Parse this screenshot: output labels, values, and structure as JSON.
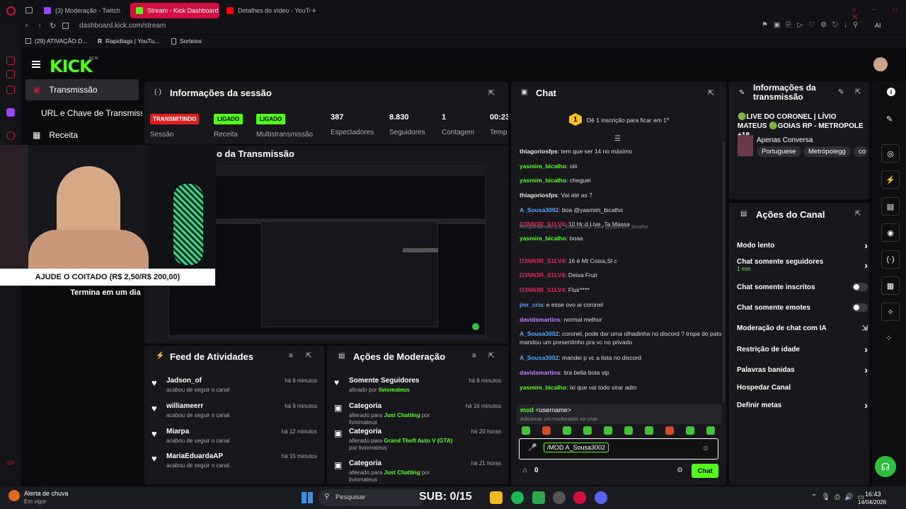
{
  "browser": {
    "tabs": [
      {
        "label": "(3) Moderação - Twitch",
        "color": "#9147ff"
      },
      {
        "label": "Stream - Kick Dashboard",
        "color": "#53fc18"
      },
      {
        "label": "Detalhes do vídeo - YouTu...",
        "color": "#ff0000"
      }
    ],
    "url": "dashboard.kick.com/stream",
    "bookmarks": [
      "(29) ATIVAÇÃO D...",
      "Rapidtags | YouTu...",
      "Sorteios"
    ]
  },
  "kick": {
    "logo": "KICK",
    "logo_sup": "BETA",
    "nav": [
      "Transmissão",
      "URL e Chave de Transmissão",
      "Receita"
    ]
  },
  "session": {
    "title": "Informações da sessão",
    "stats": [
      {
        "badge": "TRANSMITINDO",
        "label": "Sessão"
      },
      {
        "badge": "LIGADO",
        "label": "Receita"
      },
      {
        "badge": "LIGADO",
        "label": "Multistransmissão"
      },
      {
        "value": "387",
        "label": "Espectadores"
      },
      {
        "value": "8.830",
        "label": "Seguidores"
      },
      {
        "value": "1",
        "label": "Contagem"
      },
      {
        "value": "00:23",
        "label": "Temp"
      }
    ]
  },
  "preview": {
    "title_partial": "o da Transmissão"
  },
  "overlay": {
    "goal": "AJUDE O COITADO (R$ 2,50/R$ 200,00)",
    "ends": "Termina em um dia"
  },
  "activity_feed": {
    "title": "Feed de Atividades",
    "items": [
      {
        "name": "Jadson_of",
        "action": "acabou de seguir o canal",
        "time": "há 9 minutos"
      },
      {
        "name": "williameerr",
        "action": "acabou de seguir o canal",
        "time": "há 9 minutos"
      },
      {
        "name": "Miarpa",
        "action": "acabou de seguir o canal",
        "time": "há 12 minutos"
      },
      {
        "name": "MariaEduardaAP",
        "action": "acabou de seguir o canal",
        "time": "há 15 minutos"
      }
    ]
  },
  "mod_actions": {
    "title": "Ações de Moderação",
    "items": [
      {
        "name": "Somente Seguidores",
        "pre": "ativado por",
        "hl": "liviomateus",
        "post": "",
        "time": "há 8 minutos"
      },
      {
        "name": "Categoria",
        "pre": "alterado para",
        "hl": "Just Chatting",
        "post": "por liviomateus",
        "time": "há 16 minutos"
      },
      {
        "name": "Categoria",
        "pre": "alterado para",
        "hl": "Grand Theft Auto V (GTA)",
        "post": "por liviomateus",
        "time": "há 20 horas"
      },
      {
        "name": "Categoria",
        "pre": "alterado para",
        "hl": "Just Chatting",
        "post": "por liviomateus",
        "time": "há 21 horas"
      }
    ]
  },
  "chat": {
    "title": "Chat",
    "sub_goal": "Dê 1 inscrição para ficar em 1º",
    "sub_goal_num": "1",
    "messages": [
      {
        "user": "thiagoriosfps",
        "color": "#e8e8e8",
        "text": "tem que ser 14 no máximo"
      },
      {
        "user": "yasmim_bicalho",
        "color": "#53fc18",
        "text": "oiii"
      },
      {
        "user": "yasmim_bicalho",
        "color": "#53fc18",
        "text": "cheguei"
      },
      {
        "user": "thiagoriosfps",
        "color": "#e8e8e8",
        "text": "Vai até as 7"
      },
      {
        "user": "A_Sousa3002",
        "color": "#4aa8ff",
        "text": "boa @yasmim_bicalho"
      },
      {
        "user": "D3NN3R_S1LV4",
        "color": "#e0245e",
        "text": "10 Hr d Live ,Ta Massa"
      },
      {
        "reply": "Respondendo a A_Sousa3002: boa @yasmim_bicalho",
        "user": "yasmim_bicalho",
        "color": "#53fc18",
        "text": "boaa"
      },
      {
        "user": "D3NN3R_S1LV4",
        "color": "#e0245e",
        "text": "16 é Mt Coisa,Sl c"
      },
      {
        "user": "D3NN3R_S1LV4",
        "color": "#e0245e",
        "text": "Deixa Fruir"
      },
      {
        "user": "D3NN3R_S1LV4",
        "color": "#e0245e",
        "text": "Fluir****"
      },
      {
        "user": "jmr_cria",
        "color": "#4aa8ff",
        "text": "e esse ovo ai coronel"
      },
      {
        "user": "davidsmartins",
        "color": "#c77dff",
        "text": "normal melhor"
      },
      {
        "user": "A_Sousa3002",
        "color": "#4aa8ff",
        "text": "coronel, pode dar uma olhadinha no discord ? tropa do pato mandou um presentinho pra vc no privado"
      },
      {
        "user": "A_Sousa3002",
        "color": "#4aa8ff",
        "text": "mandei p vc a lista no discord"
      },
      {
        "user": "davidsmartins",
        "color": "#c77dff",
        "text": "tira bella bota vip"
      },
      {
        "user": "yasmim_bicalho",
        "color": "#53fc18",
        "text": "ixi que vai todo virar adm"
      }
    ],
    "command_hint": "mod <username>",
    "command_desc": "Adicionar um moderador ao chat",
    "input_value": "/MOD A_Sousa3002",
    "count": "0",
    "send_label": "Chat"
  },
  "stream_info": {
    "title": "Informações da transmissão",
    "stream_title": "🟢LIVE DO CORONEL | LÍVIO MATEUS 🟢GOIAS RP - METROPOLE +18",
    "category": "Apenas Conversa",
    "tags": [
      "Portuguese",
      "Metrópolegg",
      "co"
    ]
  },
  "channel_actions": {
    "title": "Ações do Canal",
    "items": [
      {
        "label": "Modo lento",
        "sub": "",
        "control": "chevron"
      },
      {
        "label": "Chat somente seguidores",
        "sub": "1 min",
        "control": "chevron"
      },
      {
        "label": "Chat somente inscritos",
        "sub": "",
        "control": "toggle"
      },
      {
        "label": "Chat somente emotes",
        "sub": "",
        "control": "toggle"
      },
      {
        "label": "Moderação de chat com IA",
        "sub": "",
        "control": "external"
      },
      {
        "label": "Restrição de idade",
        "sub": "",
        "control": "chevron"
      },
      {
        "label": "Palavras banidas",
        "sub": "",
        "control": "chevron"
      },
      {
        "label": "Hospedar Canal",
        "sub": "",
        "control": "none"
      },
      {
        "label": "Definir metas",
        "sub": "",
        "control": "chevron"
      }
    ]
  },
  "taskbar": {
    "weather_title": "Alerta de chuva",
    "weather_sub": "Em vigor",
    "search": "Pesquisar",
    "sub_overlay": "SUB: 0/15",
    "time": "16:43",
    "date": "14/04/2026"
  },
  "colors": {
    "kick_green": "#53fc18",
    "opera_red": "#d1103f"
  }
}
